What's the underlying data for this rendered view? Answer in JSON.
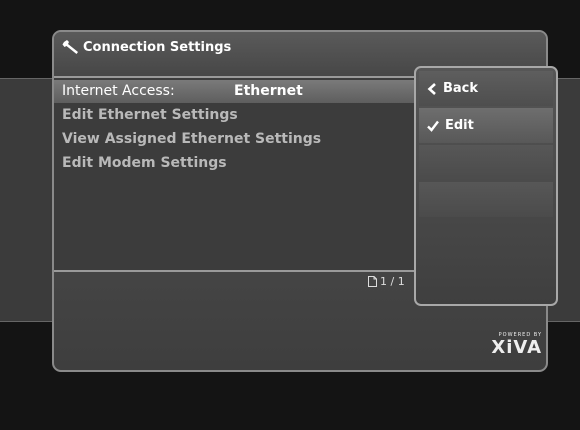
{
  "panel": {
    "title": "Connection Settings"
  },
  "list": {
    "items": [
      {
        "label": "Internet Access:",
        "value": "Ethernet"
      },
      {
        "label": "Edit Ethernet Settings"
      },
      {
        "label": "View Assigned Ethernet Settings"
      },
      {
        "label": "Edit Modem Settings"
      }
    ]
  },
  "pager": {
    "text": "1 / 1"
  },
  "menu": {
    "items": [
      {
        "label": "Back",
        "icon": "chevron-left-icon"
      },
      {
        "label": "Edit",
        "icon": "checkmark-icon"
      }
    ]
  },
  "logo": {
    "powered_by": "POWERED BY",
    "brand": "XiVA"
  },
  "colors": {
    "background": "#141414",
    "panel": "#434343",
    "selected_row": "#6a6a6a",
    "text_primary": "#ffffff",
    "text_dim": "#b9b9b9"
  }
}
